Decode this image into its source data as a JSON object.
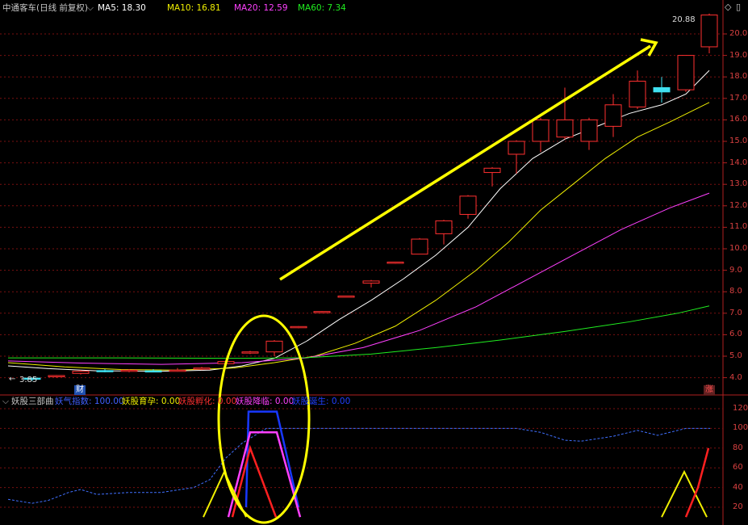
{
  "header": {
    "title": "中通客车(日线 前复权)",
    "ma": [
      {
        "label": "MA5: 18.30",
        "color": "#ffffff"
      },
      {
        "label": "MA10: 16.81",
        "color": "#f0f000"
      },
      {
        "label": "MA20: 12.59",
        "color": "#ff40ff"
      },
      {
        "label": "MA60: 7.34",
        "color": "#20ee20"
      }
    ]
  },
  "price_axis": {
    "ticks": [
      "20.0",
      "19.0",
      "18.0",
      "17.0",
      "16.0",
      "15.0",
      "14.0",
      "13.0",
      "12.0",
      "11.0",
      "10.0",
      "9.0",
      "8.0",
      "7.0",
      "6.0",
      "5.0",
      "4.0"
    ],
    "high_label": "20.88",
    "low_label": "3.85",
    "low_arrow": "←"
  },
  "markers": {
    "cai": "财",
    "zhang": "涨"
  },
  "sub": {
    "name": "妖股三部曲",
    "items": [
      {
        "label": "妖气指数: 100.00",
        "color": "#4060ff"
      },
      {
        "label": "妖股育孕: 0.00",
        "color": "#f0f000"
      },
      {
        "label": "妖股孵化: 0.00",
        "color": "#ff3030"
      },
      {
        "label": "妖股降临: 0.00",
        "color": "#ff40ff"
      },
      {
        "label": "妖股诞生: 0.00",
        "color": "#2040ff"
      }
    ],
    "ticks": [
      "120",
      "100",
      "80",
      "60",
      "40",
      "20"
    ]
  },
  "colors": {
    "up": "#ff3030",
    "down": "#40e0f0",
    "grid": "#7a1010",
    "ma5": "#ffffff",
    "ma10": "#f0f000",
    "ma20": "#ff40ff",
    "ma60": "#20ee20",
    "annotation": "#ffff00"
  },
  "icons": {
    "top_right": [
      "diamond-icon",
      "square-icon"
    ]
  }
}
